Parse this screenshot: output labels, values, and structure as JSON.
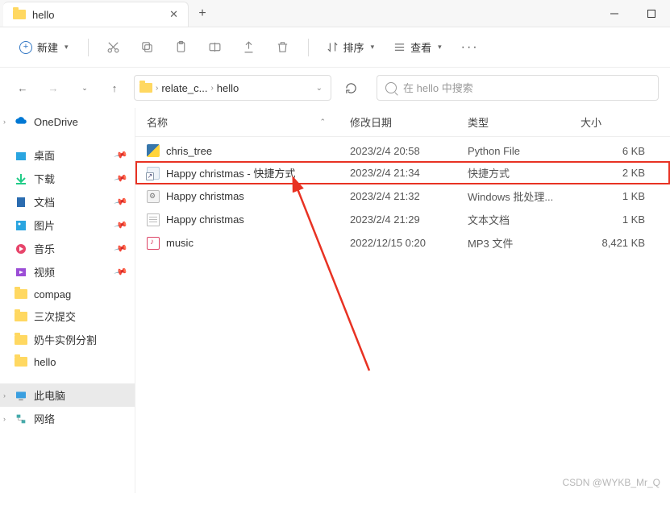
{
  "titlebar": {
    "tab_title": "hello"
  },
  "toolbar": {
    "new_label": "新建",
    "sort_label": "排序",
    "view_label": "查看"
  },
  "breadcrumb": {
    "segments": [
      "relate_c...",
      "hello"
    ]
  },
  "search": {
    "placeholder": "在 hello 中搜索"
  },
  "columns": {
    "name": "名称",
    "date": "修改日期",
    "type": "类型",
    "size": "大小"
  },
  "files": [
    {
      "name": "chris_tree",
      "date": "2023/2/4 20:58",
      "type": "Python File",
      "size": "6 KB",
      "icon": "py"
    },
    {
      "name": "Happy christmas - 快捷方式",
      "date": "2023/2/4 21:34",
      "type": "快捷方式",
      "size": "2 KB",
      "icon": "lnk"
    },
    {
      "name": "Happy christmas",
      "date": "2023/2/4 21:32",
      "type": "Windows 批处理...",
      "size": "1 KB",
      "icon": "bat"
    },
    {
      "name": "Happy christmas",
      "date": "2023/2/4 21:29",
      "type": "文本文档",
      "size": "1 KB",
      "icon": "txt"
    },
    {
      "name": "music",
      "date": "2022/12/15 0:20",
      "type": "MP3 文件",
      "size": "8,421 KB",
      "icon": "mp3"
    }
  ],
  "sidebar": {
    "onedrive": "OneDrive",
    "quick": [
      "桌面",
      "下载",
      "文档",
      "图片",
      "音乐",
      "视频",
      "compag",
      "三次提交",
      "奶牛实例分割",
      "hello"
    ],
    "this_pc": "此电脑",
    "network": "网络"
  },
  "watermark": "CSDN @WYKB_Mr_Q"
}
